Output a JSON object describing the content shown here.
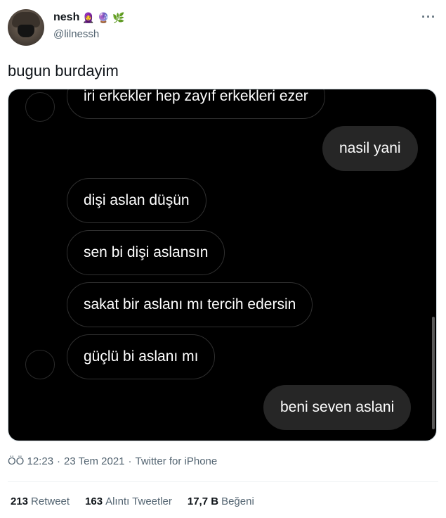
{
  "user": {
    "display_name": "nesh",
    "emojis": [
      "🧕",
      "🔮",
      "🌿"
    ],
    "handle": "@lilnessh"
  },
  "tweet": {
    "text": "bugun burdayim"
  },
  "chat": {
    "messages": [
      {
        "side": "in",
        "text": "iri erkekler hep zayıf erkekleri ezer"
      },
      {
        "side": "out",
        "text": "nasil yani"
      },
      {
        "side": "in",
        "text": "dişi aslan düşün"
      },
      {
        "side": "in",
        "text": "sen bi dişi aslansın"
      },
      {
        "side": "in",
        "text": "sakat bir aslanı mı tercih edersin"
      },
      {
        "side": "in",
        "text": "güçlü bi aslanı mı"
      },
      {
        "side": "out",
        "text": "beni seven aslani"
      }
    ]
  },
  "meta": {
    "time": "ÖÖ 12:23",
    "date": "23 Tem 2021",
    "source": "Twitter for iPhone",
    "sep": "·"
  },
  "stats": {
    "retweets": "213",
    "retweets_label": "Retweet",
    "quotes": "163",
    "quotes_label": "Alıntı Tweetler",
    "likes": "17,7 B",
    "likes_label": "Beğeni"
  },
  "colors": {
    "text": "#0f1419",
    "secondary": "#536471",
    "bubble_out": "#262626",
    "media_bg": "#000000"
  }
}
